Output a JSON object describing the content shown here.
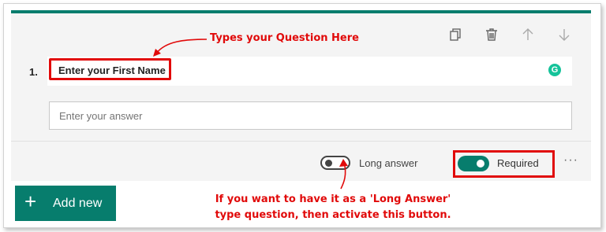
{
  "question": {
    "number": "1.",
    "title": "Enter your First Name",
    "answer_placeholder": "Enter your answer"
  },
  "toolbar": {
    "icons": [
      "copy-icon",
      "delete-icon",
      "move-up-icon",
      "move-down-icon"
    ]
  },
  "options": {
    "long_answer_label": "Long answer",
    "long_answer_enabled": false,
    "required_label": "Required",
    "required_enabled": true,
    "more_label": "···"
  },
  "add_new": {
    "label": "Add new"
  },
  "annotations": {
    "question_note": "Types your Question Here",
    "long_answer_note_line1": "If you want to have it as a 'Long Answer'",
    "long_answer_note_line2": "type question, then activate this button."
  },
  "colors": {
    "accent": "#077d6d",
    "annotation": "#e10a0a",
    "card_bg": "#f4f4f4",
    "grammarly": "#15c39a"
  }
}
